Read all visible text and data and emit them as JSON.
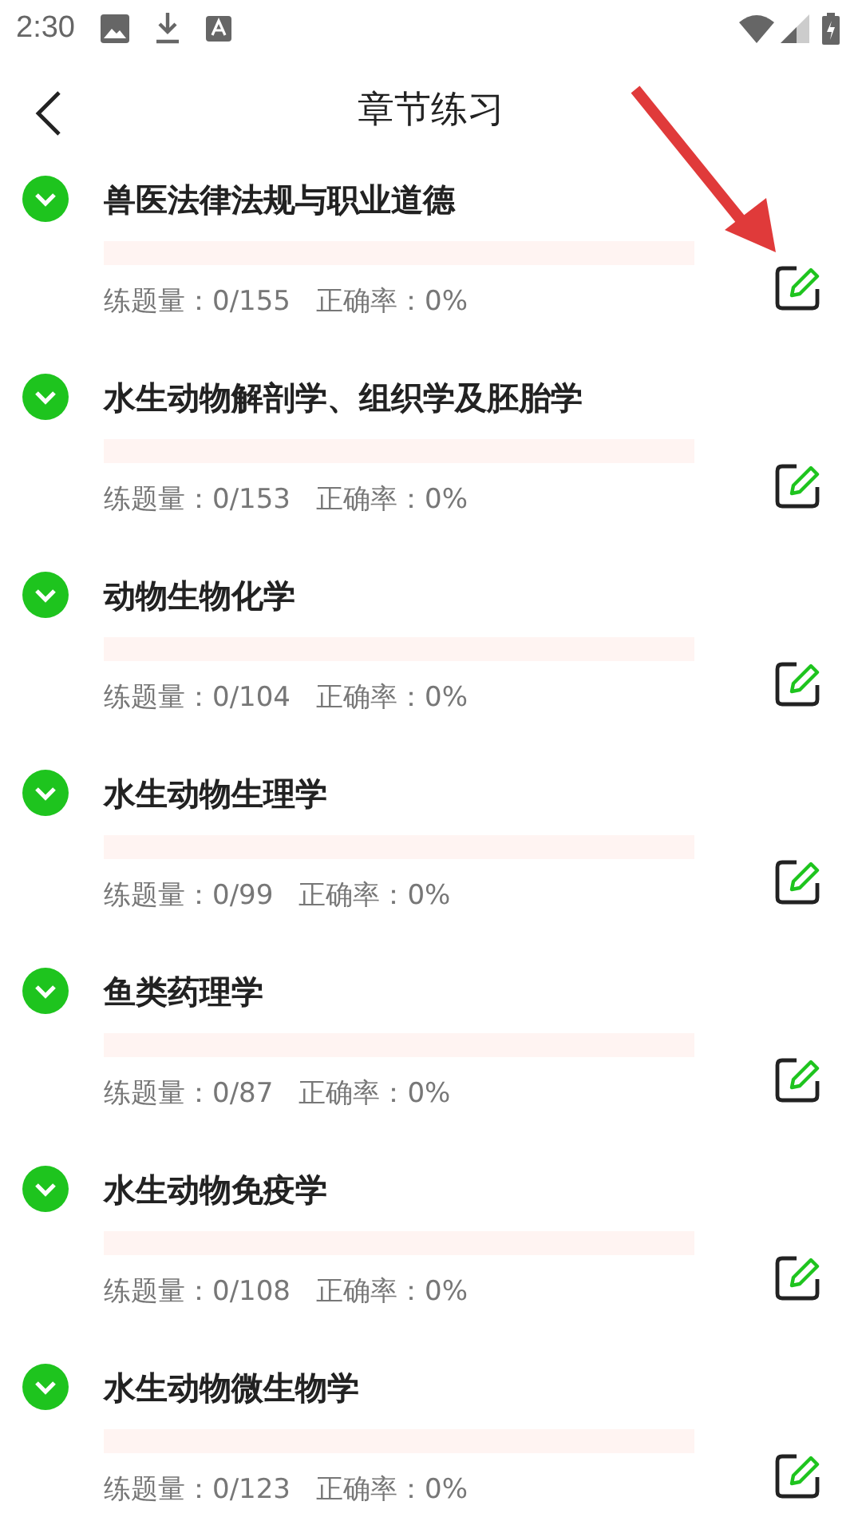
{
  "status_bar": {
    "time": "2:30"
  },
  "header": {
    "title": "章节练习"
  },
  "chapters": [
    {
      "title": "兽医法律法规与职业道德",
      "level": 0,
      "count": "练题量：0/155",
      "accuracy": "正确率：0%",
      "expanded": false
    },
    {
      "title": "水生动物解剖学、组织学及胚胎学",
      "level": 0,
      "count": "练题量：0/153",
      "accuracy": "正确率：0%",
      "expanded": false
    },
    {
      "title": "动物生物化学",
      "level": 0,
      "count": "练题量：0/104",
      "accuracy": "正确率：0%",
      "expanded": false
    },
    {
      "title": "水生动物生理学",
      "level": 0,
      "count": "练题量：0/99",
      "accuracy": "正确率：0%",
      "expanded": false
    },
    {
      "title": "鱼类药理学",
      "level": 0,
      "count": "练题量：0/87",
      "accuracy": "正确率：0%",
      "expanded": false
    },
    {
      "title": "水生动物免疫学",
      "level": 0,
      "count": "练题量：0/108",
      "accuracy": "正确率：0%",
      "expanded": false
    },
    {
      "title": "水生动物微生物学",
      "level": 0,
      "count": "练题量：0/123",
      "accuracy": "正确率：0%",
      "expanded": false
    }
  ]
}
